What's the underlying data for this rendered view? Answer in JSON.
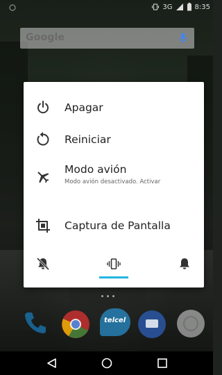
{
  "status_bar": {
    "network": "3G",
    "time": "8:35"
  },
  "search": {
    "logo": "Google"
  },
  "power_menu": {
    "items": [
      {
        "label": "Apagar",
        "icon": "power-icon"
      },
      {
        "label": "Reiniciar",
        "icon": "restart-icon"
      },
      {
        "label": "Modo avión",
        "sublabel": "Modo avión desactivado. Activar",
        "icon": "airplane-icon"
      },
      {
        "label": "Captura de Pantalla",
        "icon": "screenshot-icon"
      }
    ],
    "sound_modes": [
      {
        "name": "silent",
        "icon": "bell-off-icon"
      },
      {
        "name": "vibrate",
        "icon": "vibrate-icon",
        "selected": true
      },
      {
        "name": "sound",
        "icon": "bell-icon"
      }
    ]
  },
  "dock": {
    "apps": [
      {
        "name": "phone",
        "icon": "phone-icon"
      },
      {
        "name": "chrome",
        "icon": "chrome-icon"
      },
      {
        "name": "telcel",
        "label": "telcel",
        "icon": "telcel-icon"
      },
      {
        "name": "messages",
        "icon": "messages-icon"
      },
      {
        "name": "browser",
        "icon": "globe-icon"
      }
    ]
  },
  "colors": {
    "accent": "#22b5e0",
    "dialog_bg": "#ffffff",
    "text": "#222222"
  }
}
